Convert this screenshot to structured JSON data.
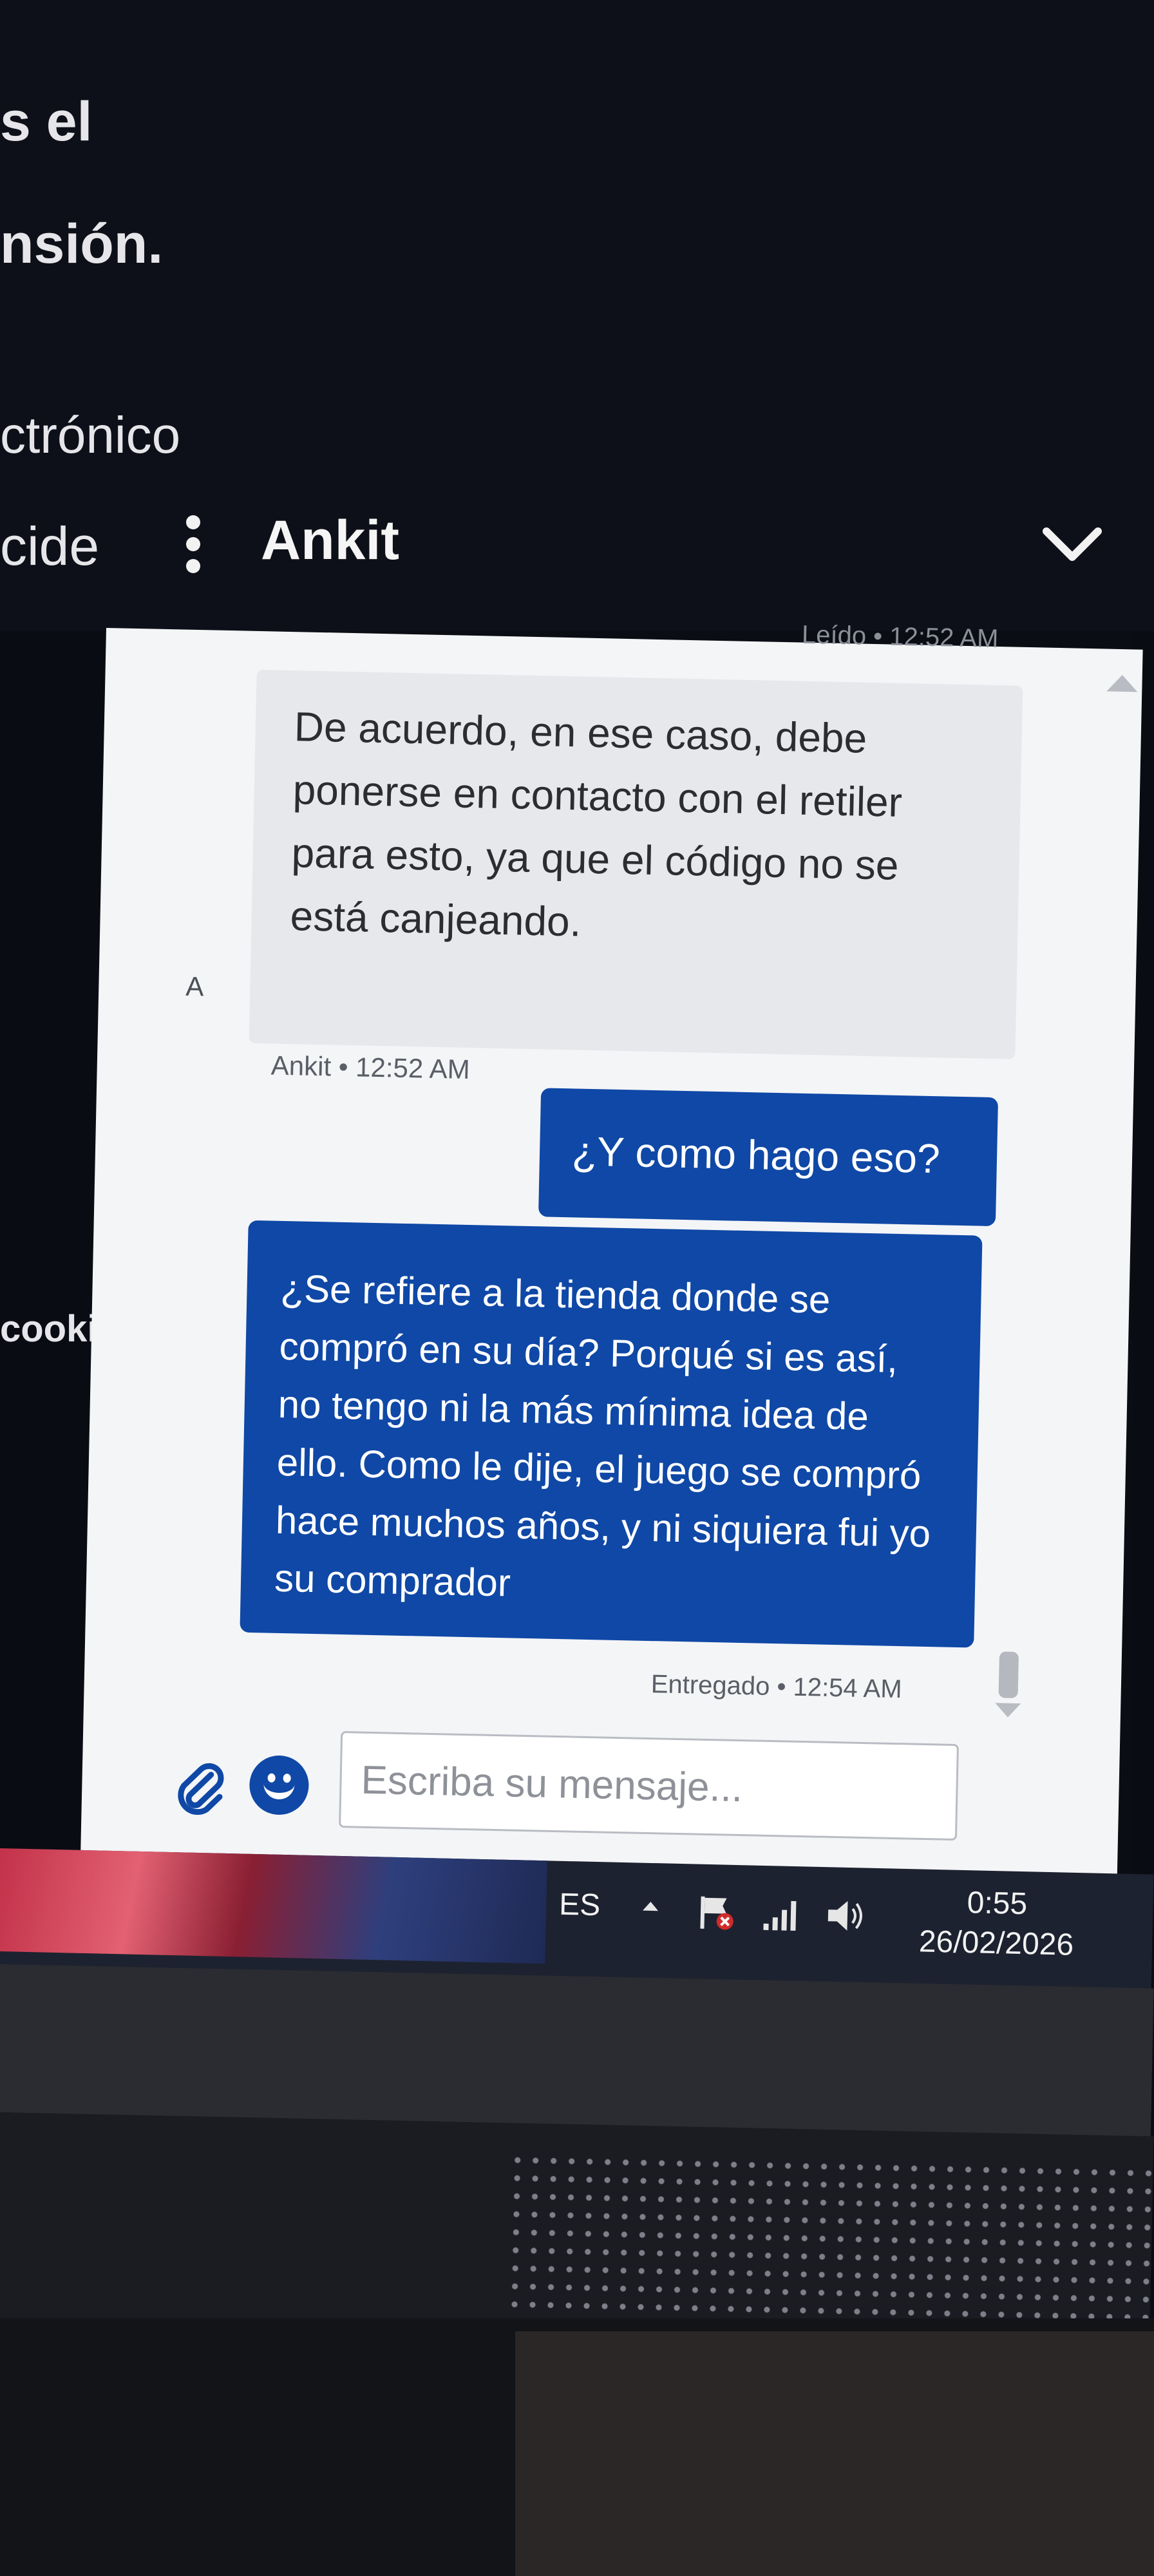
{
  "background_page": {
    "fragments": [
      "s el",
      "nsión.",
      "ctrónico",
      "cide",
      "cookie"
    ]
  },
  "chat": {
    "header": {
      "agent_name": "Ankit"
    },
    "read_receipt": "Leído • 12:52 AM",
    "messages": [
      {
        "from": "agent",
        "text": "De acuerdo, en ese caso, debe ponerse en contacto con el retiler para esto, ya que el código no se está canjeando.",
        "meta": "Ankit • 12:52 AM"
      },
      {
        "from": "user",
        "text": "¿Y como hago eso?"
      },
      {
        "from": "user",
        "text": "¿Se refiere a la tienda donde se compró en su día? Porqué si es así, no tengo ni la más mínima idea de ello. Como le dije, el juego se compró hace muchos años, y ni siquiera fui yo su comprador"
      }
    ],
    "avatar_letter": "A",
    "delivered": "Entregado • 12:54 AM",
    "input": {
      "placeholder": "Escriba su mensaje...",
      "value": ""
    }
  },
  "taskbar": {
    "language": "ES",
    "time": "0:55",
    "date": "26/02/2026"
  },
  "colors": {
    "user_bubble": "#0f48a6",
    "agent_bubble": "#e6e8ec",
    "chat_bg": "#f4f5f7",
    "page_bg": "#0e1019"
  },
  "icons": [
    "kebab-menu-icon",
    "chevron-down-icon",
    "attach-icon",
    "emoji-icon",
    "tray-arrow-icon",
    "action-center-flag-icon",
    "signal-icon",
    "volume-icon"
  ]
}
